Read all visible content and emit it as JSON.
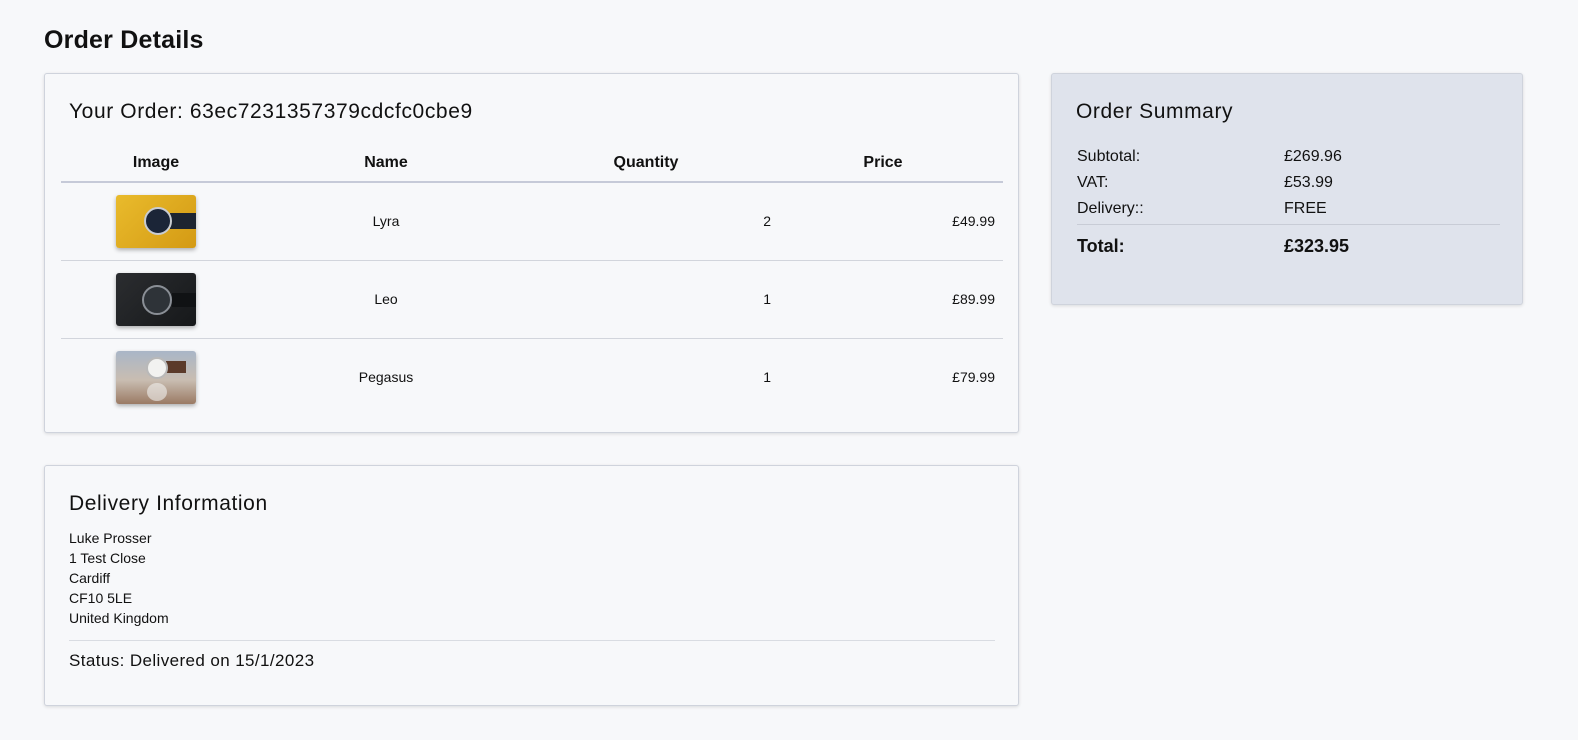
{
  "page": {
    "title": "Order Details"
  },
  "order": {
    "heading": "Your Order: 63ec7231357379cdcfc0cbe9",
    "columns": [
      "Image",
      "Name",
      "Quantity",
      "Price"
    ],
    "items": [
      {
        "image": "watch-yellow-background",
        "name": "Lyra",
        "quantity": "2",
        "price": "£49.99"
      },
      {
        "image": "watch-dark-background",
        "name": "Leo",
        "quantity": "1",
        "price": "£89.99"
      },
      {
        "image": "watch-white-face-brown-strap",
        "name": "Pegasus",
        "quantity": "1",
        "price": "£79.99"
      }
    ]
  },
  "delivery": {
    "heading": "Delivery Information",
    "address": [
      "Luke Prosser",
      "1 Test Close",
      "Cardiff",
      "CF10 5LE",
      "United Kingdom"
    ],
    "status": "Status: Delivered on 15/1/2023"
  },
  "summary": {
    "heading": "Order Summary",
    "rows": [
      {
        "label": "Subtotal:",
        "value": "£269.96"
      },
      {
        "label": "VAT:",
        "value": "£53.99"
      },
      {
        "label": "Delivery::",
        "value": "FREE"
      }
    ],
    "total": {
      "label": "Total:",
      "value": "£323.95"
    }
  },
  "colors": {
    "background": "#f7f8fa",
    "summary_background": "#dfe3ec",
    "border": "#cfd3dc"
  }
}
